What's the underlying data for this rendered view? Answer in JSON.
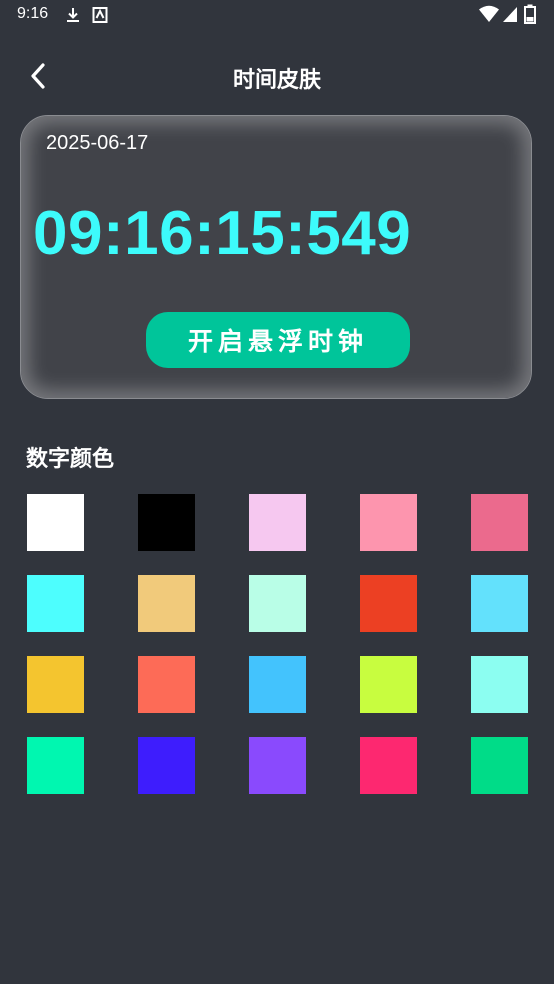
{
  "status_bar": {
    "time": "9:16"
  },
  "header": {
    "title": "时间皮肤"
  },
  "clock_card": {
    "date": "2025-06-17",
    "time": "09:16:15:549",
    "button_label": "开启悬浮时钟",
    "time_color": "#3dfbfb",
    "button_color": "#00c59a"
  },
  "color_section": {
    "title": "数字颜色",
    "swatches": [
      "#ffffff",
      "#000000",
      "#f6c8f0",
      "#fd95ae",
      "#eb6a8d",
      "#4dfefe",
      "#f1ca7b",
      "#b9fee7",
      "#ec4023",
      "#63e1fc",
      "#f4c52f",
      "#fd6b57",
      "#43c3fd",
      "#c8fd3f",
      "#8cfef1",
      "#00f7b0",
      "#3e1dfd",
      "#8a4afd",
      "#fd2870",
      "#00dc88"
    ]
  }
}
